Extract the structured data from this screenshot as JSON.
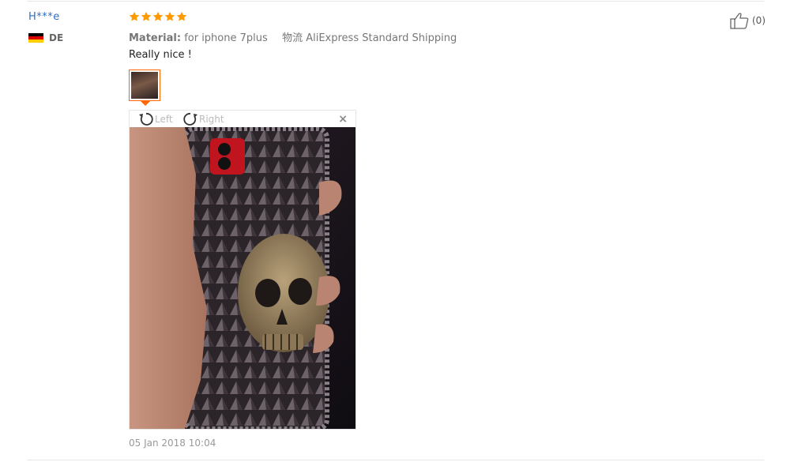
{
  "reviewer": {
    "name": "H***e",
    "country_code": "DE",
    "flag_colors": [
      "#000000",
      "#dd0000",
      "#ffce00"
    ]
  },
  "rating": {
    "stars": 5,
    "max": 5,
    "color": "#ff9900"
  },
  "attributes": {
    "material_label": "Material:",
    "material_value": "for iphone 7plus",
    "shipping_label": "物流",
    "shipping_value": "AliExpress Standard Shipping"
  },
  "review_text": "Really nice !",
  "image_viewer": {
    "rotate_left_label": "Left",
    "rotate_right_label": "Right",
    "close_symbol": "×"
  },
  "date": "05 Jan 2018 10:04",
  "helpful": {
    "count_text": "(0)",
    "icon": "thumbs-up-icon"
  },
  "colors": {
    "accent": "#ff6600",
    "link": "#2e6ec7"
  }
}
